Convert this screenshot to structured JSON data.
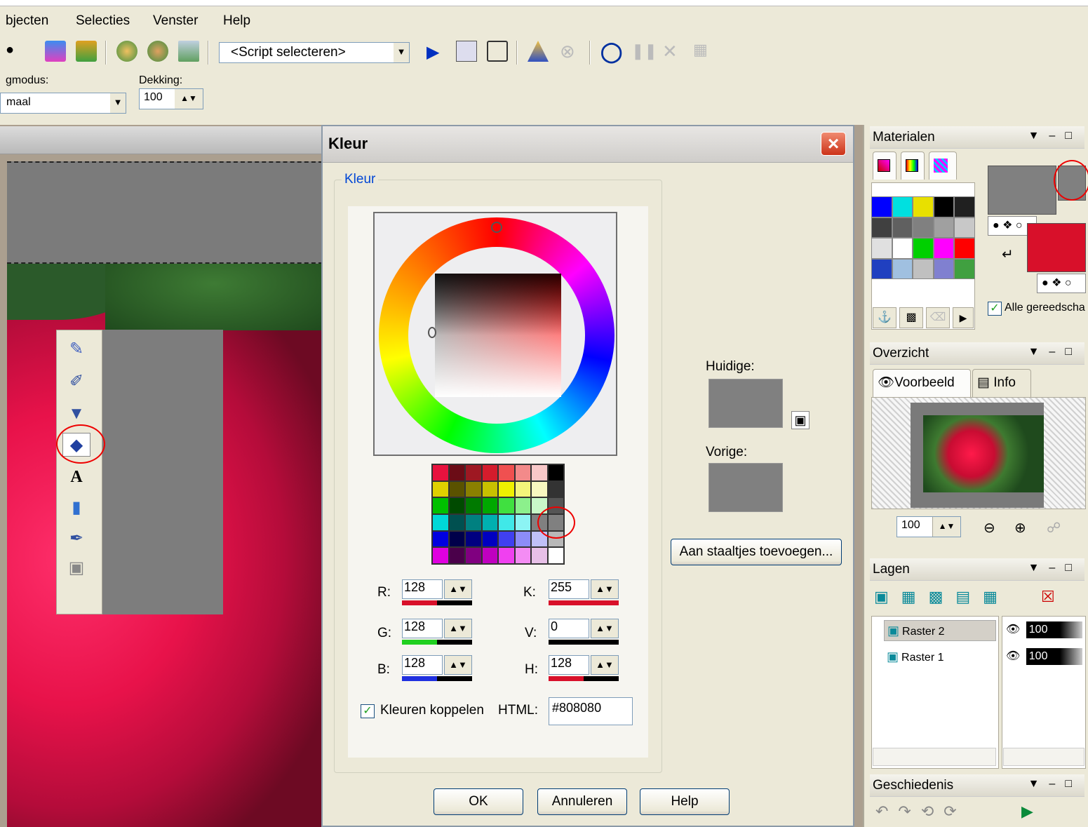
{
  "menu": {
    "items": [
      "bjecten",
      "Selecties",
      "Venster",
      "Help"
    ]
  },
  "toolbar": {
    "script_select": "<Script selecteren>"
  },
  "tool_options": {
    "mode_label": "gmodus:",
    "mode_value": "maal",
    "opacity_label": "Dekking:",
    "opacity_value": "100"
  },
  "dialog": {
    "title": "Kleur",
    "group_label": "Kleur",
    "r_label": "R:",
    "r_value": "128",
    "g_label": "G:",
    "g_value": "128",
    "b_label": "B:",
    "b_value": "128",
    "k_label": "K:",
    "k_value": "255",
    "v_label": "V:",
    "v_value": "0",
    "h_label": "H:",
    "h_value": "128",
    "link_label": "Kleuren koppelen",
    "html_label": "HTML:",
    "html_value": "#808080",
    "current_label": "Huidige:",
    "previous_label": "Vorige:",
    "add_swatch_button": "Aan staaltjes toevoegen...",
    "ok_button": "OK",
    "cancel_button": "Annuleren",
    "help_button": "Help",
    "current_color": "#808080",
    "previous_color": "#808080"
  },
  "swatches": [
    "#e8123e",
    "#6b0c16",
    "#9e1822",
    "#d41c2c",
    "#f05050",
    "#f38a8a",
    "#f8c8c8",
    "#000000",
    "#e0d000",
    "#5a5200",
    "#8a8000",
    "#c8c000",
    "#f0f000",
    "#f4f47a",
    "#f8f8c0",
    "#333333",
    "#00c000",
    "#004a00",
    "#007a00",
    "#00a800",
    "#40e040",
    "#8cf08c",
    "#c8f8c8",
    "#555555",
    "#00d8d8",
    "#005050",
    "#008080",
    "#00b0b0",
    "#40e8e8",
    "#8cf4f4",
    "#808080",
    "#808080",
    "#0000e0",
    "#00004a",
    "#000080",
    "#0000c0",
    "#4040f0",
    "#8c8cf8",
    "#c0c0f8",
    "#b8b8b8",
    "#e000e0",
    "#4a004a",
    "#800080",
    "#c000c0",
    "#f040f0",
    "#f48cf4",
    "#e8c0e8",
    "#ffffff"
  ],
  "materials_panel": {
    "title": "Materialen",
    "all_tools_label": "Alle gereedscha",
    "foreground": "#808080",
    "background": "#d8102a",
    "palette": [
      "#0000ff",
      "#00e0e0",
      "#e8e000",
      "#000000",
      "#202020",
      "#404040",
      "#606060",
      "#808080",
      "#a0a0a0",
      "#c8c8c8",
      "#e0e0e0",
      "#ffffff",
      "#00d000",
      "#ff00ff",
      "#ff0000",
      "#2040c0",
      "#a0c0e0",
      "#c0c0c0",
      "#8080d0",
      "#40a040"
    ]
  },
  "overview_panel": {
    "title": "Overzicht",
    "tab_preview": "Voorbeeld",
    "tab_info": "Info",
    "zoom_value": "100"
  },
  "layers_panel": {
    "title": "Lagen",
    "layers": [
      {
        "name": "Raster 2",
        "opacity": "100"
      },
      {
        "name": "Raster 1",
        "opacity": "100"
      }
    ]
  },
  "history_panel": {
    "title": "Geschiedenis"
  }
}
